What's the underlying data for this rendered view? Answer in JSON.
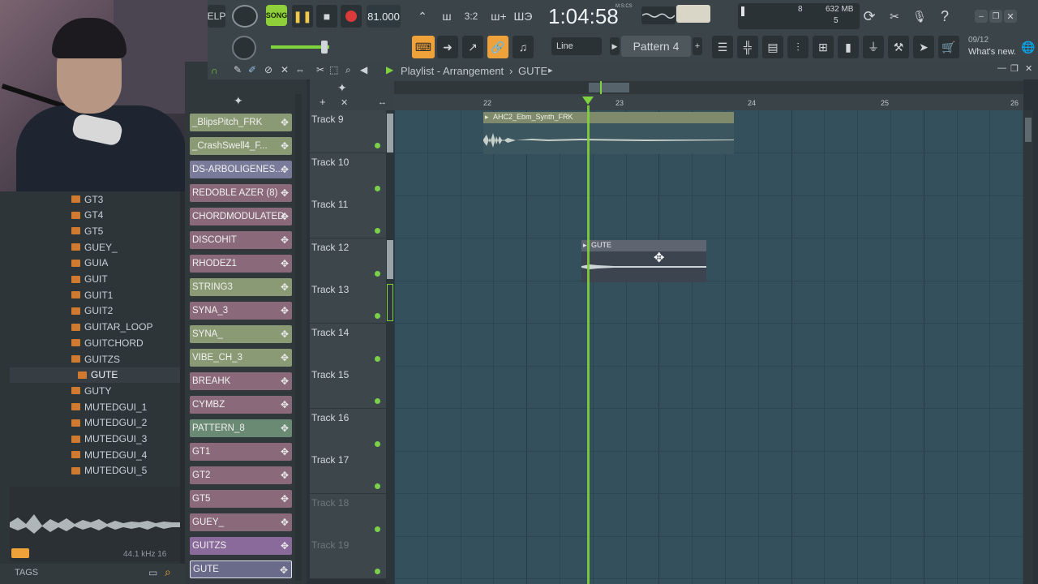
{
  "toolbar": {
    "help_label": "ELP",
    "song_label": "SONG",
    "tempo": "81.000",
    "time": "1:04:58",
    "time_unit": "M:S:CS",
    "cpu_voices": "8",
    "memory": "632 MB",
    "poly": "5",
    "snap_label": "Line",
    "pattern_label": "Pattern 4",
    "news_date": "09/12",
    "news_label": "What's new."
  },
  "playlist": {
    "title": "Playlist - Arrangement",
    "arrangement": "GUTE",
    "bars": [
      "22",
      "23",
      "24",
      "25",
      "26"
    ],
    "tracks": [
      "Track 9",
      "Track 10",
      "Track 11",
      "Track 12",
      "Track 13",
      "Track 14",
      "Track 15",
      "Track 16",
      "Track 17",
      "Track 18",
      "Track 19"
    ],
    "clips": [
      {
        "name": "AHC2_Ebm_Synth_FRK"
      },
      {
        "name": "GUTE"
      }
    ]
  },
  "browser": {
    "items": [
      "GT3",
      "GT4",
      "GT5",
      "GUEY_",
      "GUIA",
      "GUIT",
      "GUIT1",
      "GUIT2",
      "GUITAR_LOOP",
      "GUITCHORD",
      "GUITZS",
      "GUTE",
      "GUTY",
      "MUTEDGUI_1",
      "MUTEDGUI_2",
      "MUTEDGUI_3",
      "MUTEDGUI_4",
      "MUTEDGUI_5"
    ],
    "selected": "GUTE",
    "sample_info": "44.1 kHz 16",
    "tags_label": "TAGS"
  },
  "picker": {
    "items": [
      {
        "label": "_BlipsPitch_FRK",
        "color": "#8a9a74"
      },
      {
        "label": "_CrashSwell4_F...",
        "color": "#8a9a74"
      },
      {
        "label": "DS-ARBOLIGENES...",
        "color": "#7a7a9a"
      },
      {
        "label": "REDOBLE AZER (8)",
        "color": "#8a6a7a"
      },
      {
        "label": "CHORDMODULATED",
        "color": "#8a6a7a"
      },
      {
        "label": "DISCOHIT",
        "color": "#8a6a7a"
      },
      {
        "label": "RHODEZ1",
        "color": "#8a6a7a"
      },
      {
        "label": "STRING3",
        "color": "#8a9a74"
      },
      {
        "label": "SYNA_3",
        "color": "#8a6a7a"
      },
      {
        "label": "SYNA_",
        "color": "#8a9a74"
      },
      {
        "label": "VIBE_CH_3",
        "color": "#8a9a74"
      },
      {
        "label": "BREAHK",
        "color": "#8a6a7a"
      },
      {
        "label": "CYMBZ",
        "color": "#8a6a7a"
      },
      {
        "label": "PATTERN_8",
        "color": "#6a8a74"
      },
      {
        "label": "GT1",
        "color": "#8a6a7a"
      },
      {
        "label": "GT2",
        "color": "#8a6a7a"
      },
      {
        "label": "GT5",
        "color": "#8a6a7a"
      },
      {
        "label": "GUEY_",
        "color": "#8a6a7a"
      },
      {
        "label": "GUITZS",
        "color": "#8a6a9a"
      },
      {
        "label": "GUTE",
        "color": "#6a6a8a"
      }
    ]
  },
  "colors": {
    "accent_green": "#7fd33c",
    "record_red": "#d93a3a",
    "song_green": "#8fcf3a",
    "folder_orange": "#cf7a2f",
    "grid_bg": "#33505c"
  }
}
